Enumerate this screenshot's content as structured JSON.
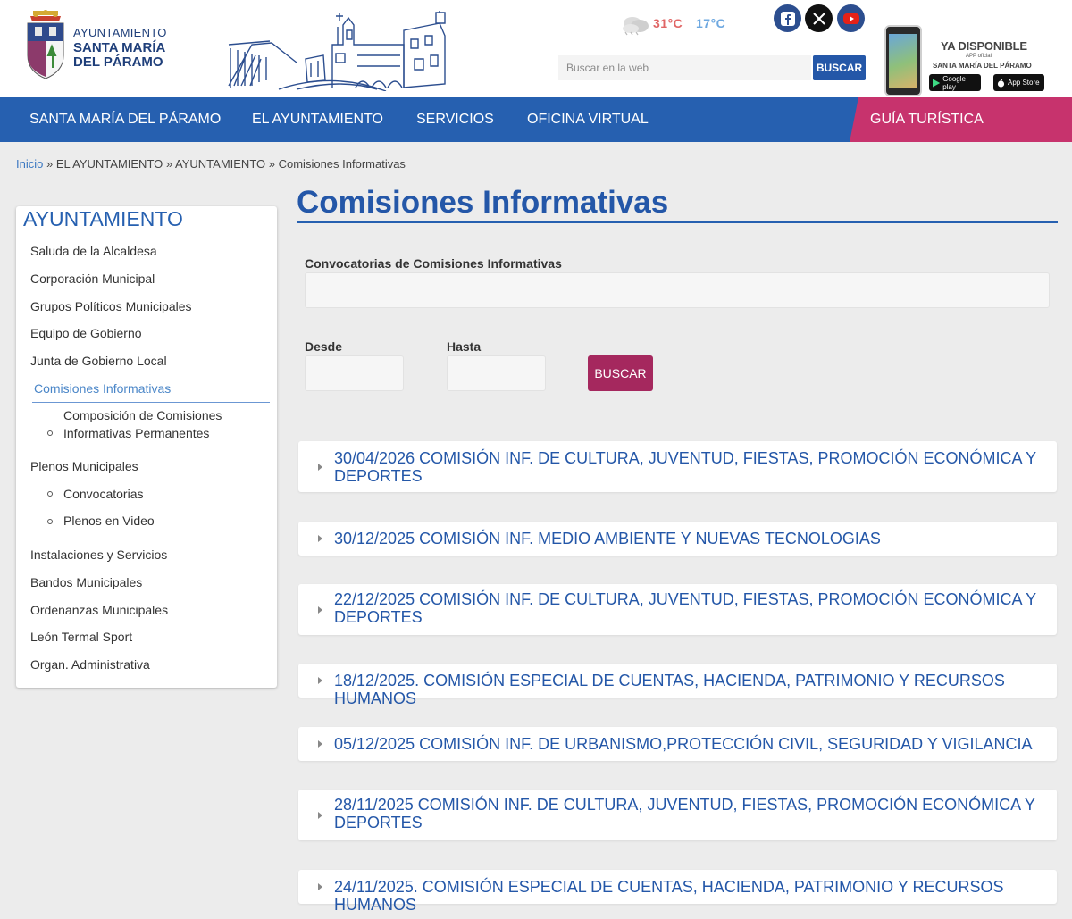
{
  "header": {
    "logo": {
      "line1": "AYUNTAMIENTO",
      "line2": "SANTA MARÍA",
      "line3": "DEL PÁRAMO"
    },
    "weather": {
      "icon": "cloud-sun-icon",
      "max": "31°C",
      "min": "17°C"
    },
    "social": [
      "facebook-icon",
      "x-icon",
      "youtube-icon"
    ],
    "search": {
      "placeholder": "Buscar en la web",
      "button": "BUSCAR"
    },
    "app_promo": {
      "title": "YA DISPONIBLE",
      "sub": "APP oficial",
      "name": "SANTA MARÍA DEL PÁRAMO",
      "google_play": "Google play",
      "app_store": "App Store"
    }
  },
  "nav": {
    "items": [
      "SANTA MARÍA DEL PÁRAMO",
      "EL AYUNTAMIENTO",
      "SERVICIOS",
      "OFICINA VIRTUAL"
    ],
    "guia": "GUÍA TURÍSTICA"
  },
  "breadcrumb": {
    "home": "Inicio",
    "sep": " » ",
    "b1": "EL AYUNTAMIENTO",
    "b2": "AYUNTAMIENTO",
    "current": "Comisiones Informativas"
  },
  "sidebar": {
    "title": "AYUNTAMIENTO",
    "items": [
      "Saluda de la Alcaldesa",
      "Corporación Municipal",
      "Grupos Políticos Municipales",
      "Equipo de Gobierno",
      "Junta de Gobierno Local"
    ],
    "active": "Comisiones Informativas",
    "active_sub_line1": "Composición de Comisiones",
    "active_sub_line2": "Informativas Permanentes",
    "plenos": "Plenos Municipales",
    "plenos_sub": [
      "Convocatorias",
      "Plenos en Video"
    ],
    "items2": [
      "Instalaciones y Servicios",
      "Bandos Municipales",
      "Ordenanzas Municipales",
      "León Termal Sport",
      "Organ. Administrativa"
    ]
  },
  "main": {
    "title": "Comisiones Informativas",
    "filter_label": "Convocatorias de Comisiones Informativas",
    "desde": "Desde",
    "hasta": "Hasta",
    "search_button": "BUSCAR",
    "entries": [
      "30/04/2026 COMISIÓN INF. DE CULTURA, JUVENTUD, FIESTAS, PROMOCIÓN ECONÓMICA Y DEPORTES",
      "30/12/2025 COMISIÓN INF. MEDIO AMBIENTE Y NUEVAS TECNOLOGIAS",
      "22/12/2025 COMISIÓN INF. DE CULTURA, JUVENTUD, FIESTAS, PROMOCIÓN ECONÓMICA Y DEPORTES",
      "18/12/2025. COMISIÓN ESPECIAL DE CUENTAS, HACIENDA, PATRIMONIO Y RECURSOS HUMANOS",
      "05/12/2025 COMISIÓN INF. DE URBANISMO,PROTECCIÓN CIVIL, SEGURIDAD Y VIGILANCIA",
      "28/11/2025 COMISIÓN INF. DE CULTURA, JUVENTUD, FIESTAS, PROMOCIÓN ECONÓMICA Y DEPORTES",
      "24/11/2025. COMISIÓN ESPECIAL DE CUENTAS, HACIENDA, PATRIMONIO Y RECURSOS HUMANOS"
    ]
  }
}
